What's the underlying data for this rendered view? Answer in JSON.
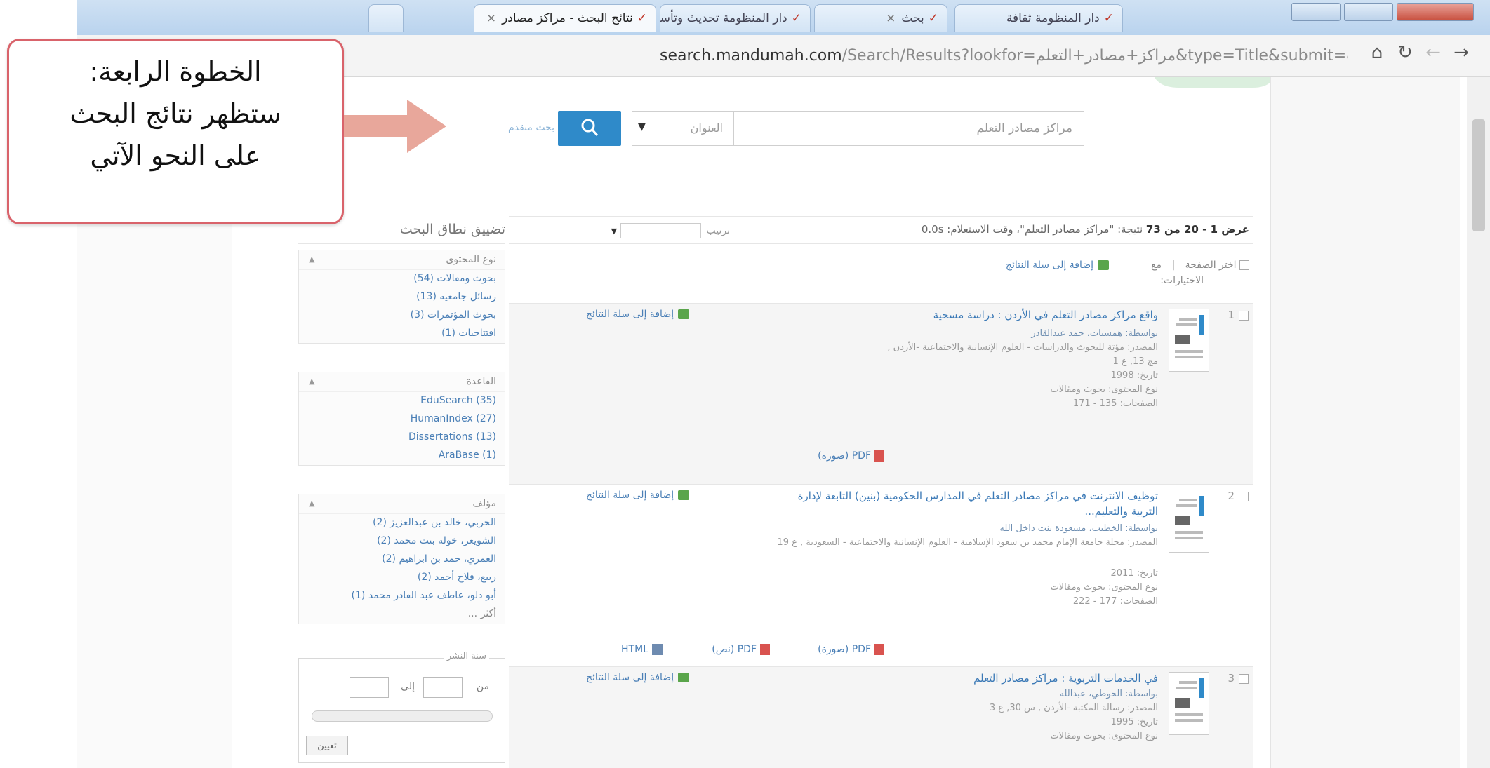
{
  "browser": {
    "tabs": [
      {
        "label": "دار المنظومة ثقافة"
      },
      {
        "label": "بحث"
      },
      {
        "label": "دار المنظومة تحديث وتأسيس"
      },
      {
        "label": "نتائج البحث - مراكز مصادر"
      },
      {
        "label": ""
      }
    ],
    "url_host": "search.mandumah.com",
    "url_path": "/Search/Results?lookfor=مراكز+مصادر+التعلم&type=Title&submit=بحث"
  },
  "callout": {
    "line1": "الخطوة الرابعة:",
    "line2": "ستظهر نتائج البحث",
    "line3": "على النحو الآتي"
  },
  "search": {
    "query": "مراكز مصادر التعلم",
    "type": "العنوان",
    "advanced_label": "بحث متقدم"
  },
  "results_header": {
    "range": "عرض 1 - 20 من 73",
    "for_text": "نتيجة: \"مراكز مصادر التعلم\"، وقت الاستعلام: 0.0s",
    "sort_label": "ترتيب"
  },
  "facets": {
    "title": "تضييق نطاق البحث",
    "groups": [
      {
        "head": "نوع المحتوى",
        "items": [
          "بحوث ومقالات (54)",
          "رسائل جامعية (13)",
          "بحوث المؤتمرات (3)",
          "افتتاحيات (1)"
        ]
      },
      {
        "head": "القاعدة",
        "items": [
          "EduSearch (35)",
          "HumanIndex (27)",
          "Dissertations (13)",
          "AraBase (1)"
        ]
      },
      {
        "head": "مؤلف",
        "items": [
          "الحربي، خالد بن عبدالعزيز (2)",
          "الشويعر، خولة بنت محمد (2)",
          "العمري، حمد بن ابراهيم (2)",
          "ربيع، فلاح أحمد (2)",
          "أبو دلو، عاطف عبد القادر محمد (1)",
          "أكثر ..."
        ]
      },
      {
        "head": "سنة النشر",
        "from_label": "من",
        "to_label": "إلى",
        "button": "تعيين"
      }
    ]
  },
  "selection": {
    "select_page": "اختر الصفحة",
    "with": "مع",
    "selected": "الاختيارات:",
    "add_to_cart": "إضافة إلى سلة النتائج"
  },
  "results": [
    {
      "num": "1",
      "title": "واقع مراكز مصادر التعلم في الأردن : دراسة مسحية",
      "author": "بواسطة: همسيات، حمد عبدالقادر",
      "source": "المصدر: مؤتة للبحوث والدراسات - العلوم الإنسانية والاجتماعية -الأردن ,",
      "vol": "مج 13, ع 1",
      "date": "تاريخ: 1998",
      "ctype": "نوع المحتوى: بحوث ومقالات",
      "pages": "الصفحات: 135 - 171",
      "add": "إضافة إلى سلة النتائج",
      "formats": [
        "PDF (صورة)"
      ]
    },
    {
      "num": "2",
      "title": "توظيف الانترنت في مراكز مصادر التعلم في المدارس الحكومية (بنين) التابعة لإدارة التربية والتعليم...",
      "author": "بواسطة: الخطيب، مسعودة بنت داخل الله",
      "source": "المصدر: مجلة جامعة الإمام محمد بن سعود الإسلامية - العلوم الإنسانية والاجتماعية - السعودية , ع 19",
      "vol": "",
      "date": "تاريخ: 2011",
      "ctype": "نوع المحتوى: بحوث ومقالات",
      "pages": "الصفحات: 177 - 222",
      "add": "إضافة إلى سلة النتائج",
      "formats": [
        "PDF (صورة)",
        "PDF (نص)",
        "HTML"
      ]
    },
    {
      "num": "3",
      "title": "في الخدمات التربوية : مراكز مصادر التعلم",
      "author": "بواسطة: الحوطي، عبدالله",
      "source": "المصدر: رسالة المكتبة -الأردن , س 30, ع 3",
      "vol": "",
      "date": "تاريخ: 1995",
      "ctype": "نوع المحتوى: بحوث ومقالات",
      "pages": "",
      "add": "إضافة إلى سلة النتائج",
      "formats": []
    }
  ],
  "colors": {
    "callout_border": "#d9636b",
    "arrow": "#e8a79b",
    "search_button": "#2f8ac9",
    "link": "#3b79b6"
  }
}
